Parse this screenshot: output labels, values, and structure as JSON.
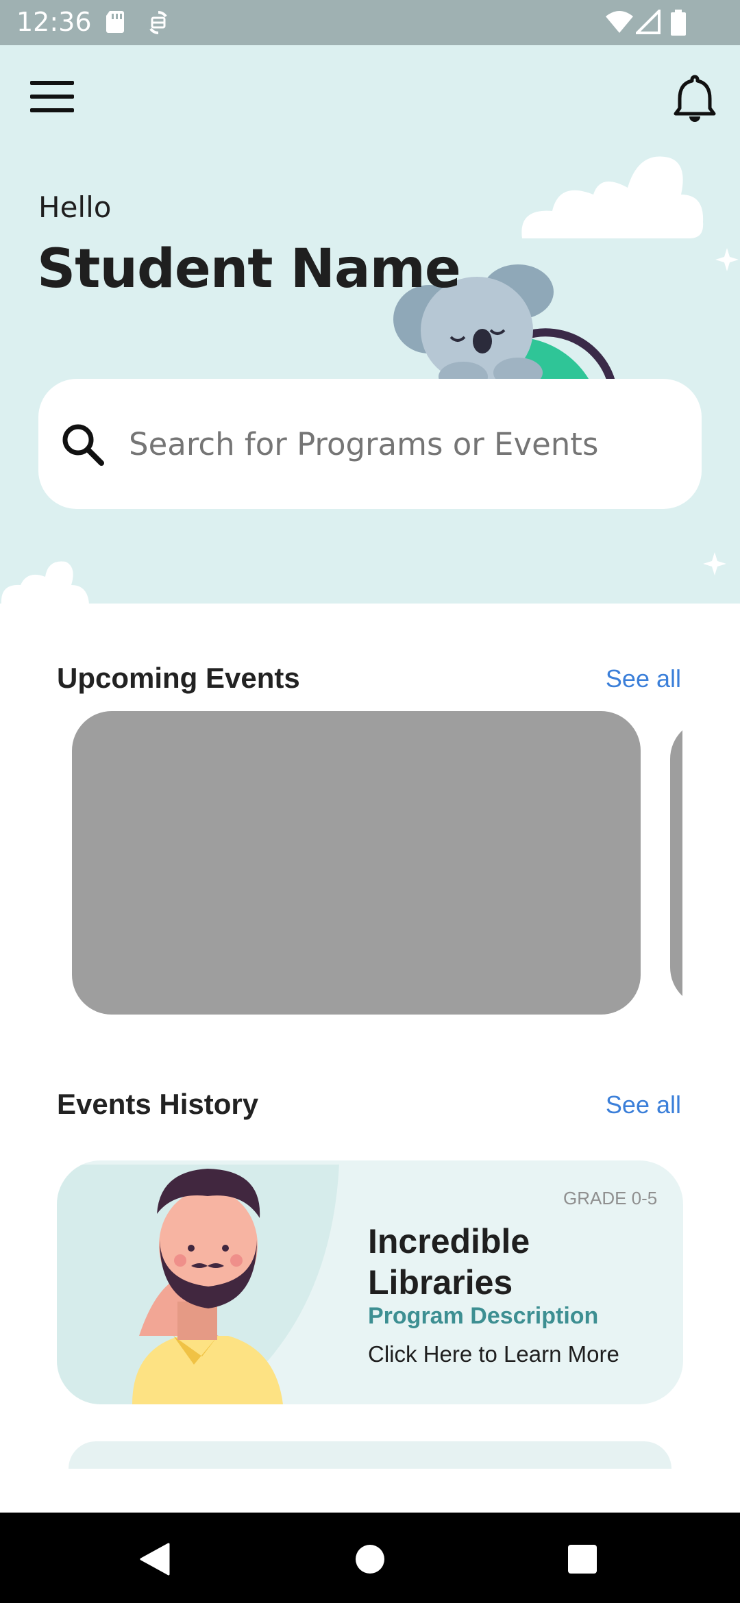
{
  "status_bar": {
    "time": "12:36",
    "icons": [
      "sd-card-icon",
      "sync-icon",
      "wifi-icon",
      "signal-icon",
      "battery-icon"
    ]
  },
  "header": {
    "greeting": "Hello",
    "name": "Student Name"
  },
  "search": {
    "placeholder": "Search for Programs or Events",
    "value": ""
  },
  "upcoming": {
    "title": "Upcoming Events",
    "see_all": "See all"
  },
  "history": {
    "title": "Events History",
    "see_all": "See all",
    "cards": [
      {
        "grade": "GRADE 0-5",
        "title": "Incredible Libraries",
        "description": "Program Description",
        "link": "Click Here to Learn More"
      }
    ]
  },
  "colors": {
    "hero_bg": "#dcf0f0",
    "status_bar": "#9fb1b2",
    "accent_link": "#3b7fd9",
    "desc_teal": "#3d8f92",
    "placeholder_card": "#9e9e9e"
  }
}
